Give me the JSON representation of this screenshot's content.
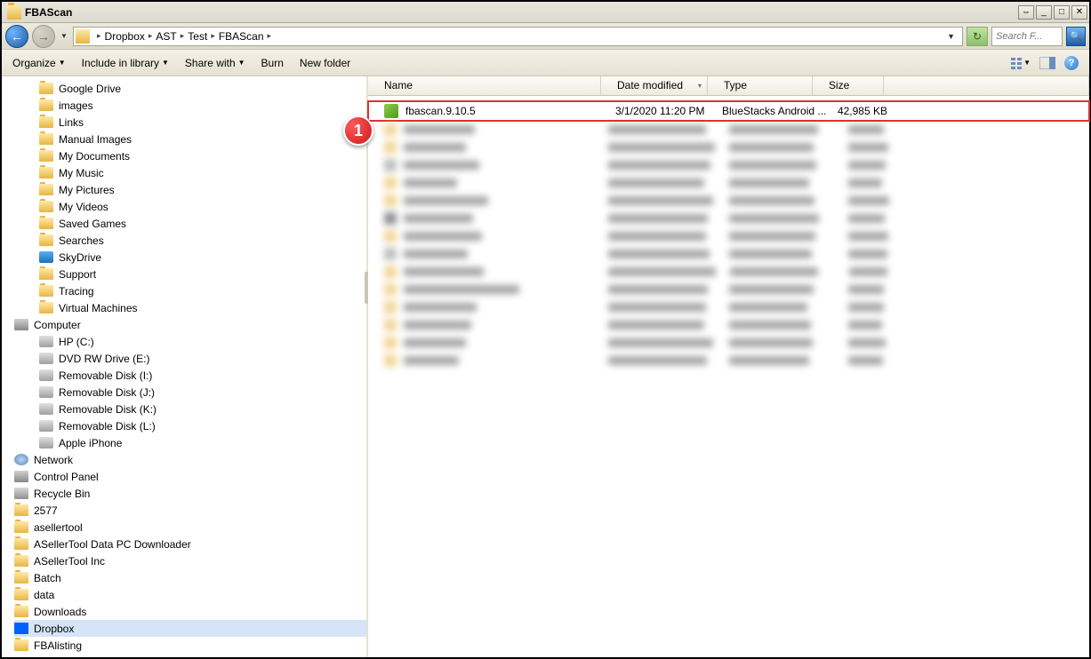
{
  "window": {
    "title": "FBAScan"
  },
  "breadcrumb": {
    "parts": [
      "Dropbox",
      "AST",
      "Test",
      "FBAScan"
    ]
  },
  "search": {
    "placeholder": "Search F..."
  },
  "toolbar": {
    "organize": "Organize",
    "include": "Include in library",
    "share": "Share with",
    "burn": "Burn",
    "newfolder": "New folder"
  },
  "columns": {
    "name": "Name",
    "date": "Date modified",
    "type": "Type",
    "size": "Size"
  },
  "tree": [
    {
      "label": "Google Drive",
      "indent": 1,
      "ico": ""
    },
    {
      "label": "images",
      "indent": 1,
      "ico": ""
    },
    {
      "label": "Links",
      "indent": 1,
      "ico": ""
    },
    {
      "label": "Manual Images",
      "indent": 1,
      "ico": ""
    },
    {
      "label": "My Documents",
      "indent": 1,
      "ico": ""
    },
    {
      "label": "My Music",
      "indent": 1,
      "ico": ""
    },
    {
      "label": "My Pictures",
      "indent": 1,
      "ico": ""
    },
    {
      "label": "My Videos",
      "indent": 1,
      "ico": ""
    },
    {
      "label": "Saved Games",
      "indent": 1,
      "ico": ""
    },
    {
      "label": "Searches",
      "indent": 1,
      "ico": ""
    },
    {
      "label": "SkyDrive",
      "indent": 1,
      "ico": "sky"
    },
    {
      "label": "Support",
      "indent": 1,
      "ico": ""
    },
    {
      "label": "Tracing",
      "indent": 1,
      "ico": ""
    },
    {
      "label": "Virtual Machines",
      "indent": 1,
      "ico": ""
    },
    {
      "label": "Computer",
      "indent": 0,
      "ico": "computer"
    },
    {
      "label": "HP (C:)",
      "indent": 1,
      "ico": "drive"
    },
    {
      "label": "DVD RW Drive (E:)",
      "indent": 1,
      "ico": "drive"
    },
    {
      "label": "Removable Disk (I:)",
      "indent": 1,
      "ico": "drive"
    },
    {
      "label": "Removable Disk (J:)",
      "indent": 1,
      "ico": "drive"
    },
    {
      "label": "Removable Disk (K:)",
      "indent": 1,
      "ico": "drive"
    },
    {
      "label": "Removable Disk (L:)",
      "indent": 1,
      "ico": "drive"
    },
    {
      "label": "Apple iPhone",
      "indent": 1,
      "ico": "drive"
    },
    {
      "label": "Network",
      "indent": 0,
      "ico": "network"
    },
    {
      "label": "Control Panel",
      "indent": 0,
      "ico": "computer"
    },
    {
      "label": "Recycle Bin",
      "indent": 0,
      "ico": "recycle"
    },
    {
      "label": "2577",
      "indent": 0,
      "ico": ""
    },
    {
      "label": "asellertool",
      "indent": 0,
      "ico": ""
    },
    {
      "label": "ASellerTool Data PC Downloader",
      "indent": 0,
      "ico": ""
    },
    {
      "label": "ASellerTool Inc",
      "indent": 0,
      "ico": ""
    },
    {
      "label": "Batch",
      "indent": 0,
      "ico": ""
    },
    {
      "label": "data",
      "indent": 0,
      "ico": ""
    },
    {
      "label": "Downloads",
      "indent": 0,
      "ico": ""
    },
    {
      "label": "Dropbox",
      "indent": 0,
      "ico": "dropbox",
      "selected": true
    },
    {
      "label": "FBAlisting",
      "indent": 0,
      "ico": ""
    }
  ],
  "files": [
    {
      "name": "fbascan.9.10.5",
      "date": "3/1/2020 11:20 PM",
      "type": "BlueStacks Android ...",
      "size": "42,985 KB",
      "highlight": true
    }
  ],
  "callout": {
    "num": "1"
  }
}
